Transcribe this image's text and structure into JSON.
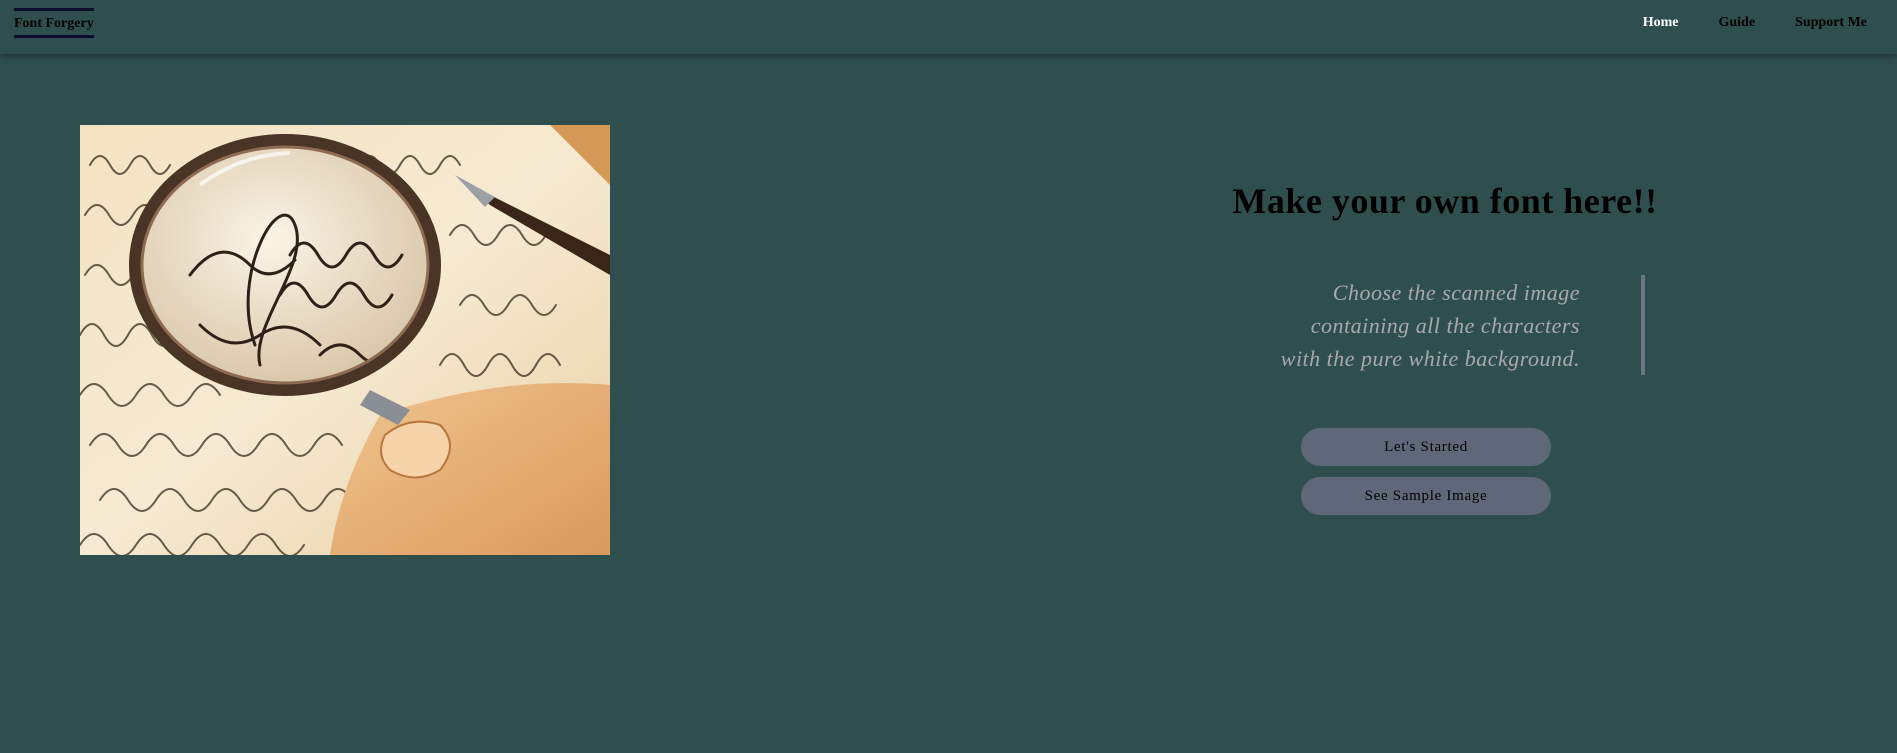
{
  "nav": {
    "brand": "Font Forgery",
    "links": [
      {
        "label": "Home",
        "active": true
      },
      {
        "label": "Guide",
        "active": false
      },
      {
        "label": "Support Me",
        "active": false
      }
    ]
  },
  "hero": {
    "image_description": "hand holding magnifying glass over calligraphy writing",
    "title": "Make your own font here!!",
    "subtitle_lines": [
      "Choose the scanned image",
      "containing all the characters",
      "with the pure white background."
    ],
    "buttons": {
      "start": "Let's Started",
      "sample": "See Sample Image"
    }
  },
  "colors": {
    "background": "#2f4f4f",
    "button": "#5e6878",
    "subtitle": "#a9a9a9",
    "quote_bar": "#6b7585"
  }
}
